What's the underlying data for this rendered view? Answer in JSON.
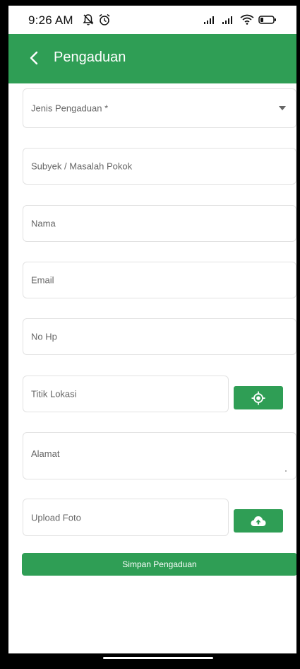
{
  "status_bar": {
    "time": "9:26 AM"
  },
  "app_bar": {
    "title": "Pengaduan"
  },
  "form": {
    "jenis_pengaduan_label": "Jenis Pengaduan *",
    "subyek_label": "Subyek / Masalah Pokok",
    "nama_label": "Nama",
    "email_label": "Email",
    "no_hp_label": "No Hp",
    "titik_lokasi_label": "Titik Lokasi",
    "alamat_label": "Alamat",
    "upload_foto_label": "Upload Foto",
    "submit_label": "Simpan Pengaduan"
  },
  "icons": {
    "back": "chevron-left-icon",
    "location": "gps-target-icon",
    "upload": "cloud-upload-icon"
  },
  "colors": {
    "primary": "#2f9e55",
    "field_border": "#e2e2e2",
    "label_text": "#666666"
  }
}
